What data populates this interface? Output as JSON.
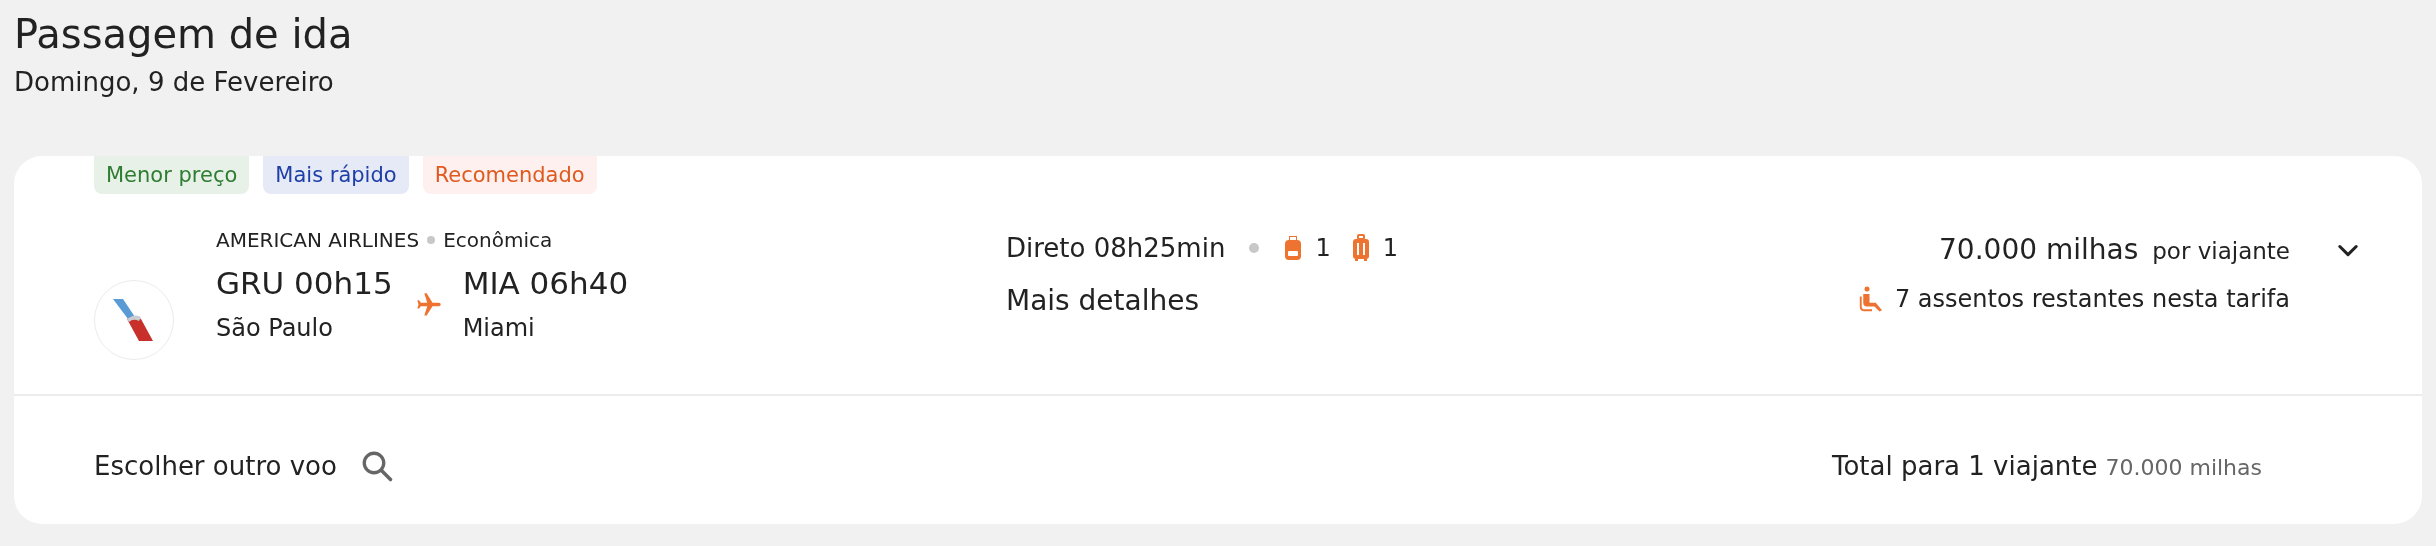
{
  "page": {
    "title": "Passagem de ida",
    "date": "Domingo, 9 de Fevereiro"
  },
  "flight": {
    "tags": [
      {
        "label": "Menor preço",
        "kind": "cheapest"
      },
      {
        "label": "Mais rápido",
        "kind": "fastest"
      },
      {
        "label": "Recomendado",
        "kind": "recommended"
      }
    ],
    "airline": "AMERICAN AIRLINES",
    "cabin": "Econômica",
    "departure": {
      "code_time": "GRU 00h15",
      "city": "São Paulo"
    },
    "arrival": {
      "code_time": "MIA 06h40",
      "city": "Miami"
    },
    "duration": "Direto 08h25min",
    "backpack_count": "1",
    "suitcase_count": "1",
    "details_link": "Mais detalhes",
    "price": "70.000 milhas",
    "price_unit": "por viajante",
    "seats": "7 assentos restantes nesta tarifa",
    "expanded": false
  },
  "footer": {
    "other_flight": "Escolher outro voo",
    "total_label": "Total para 1 viajante",
    "total_value": "70.000 milhas"
  }
}
